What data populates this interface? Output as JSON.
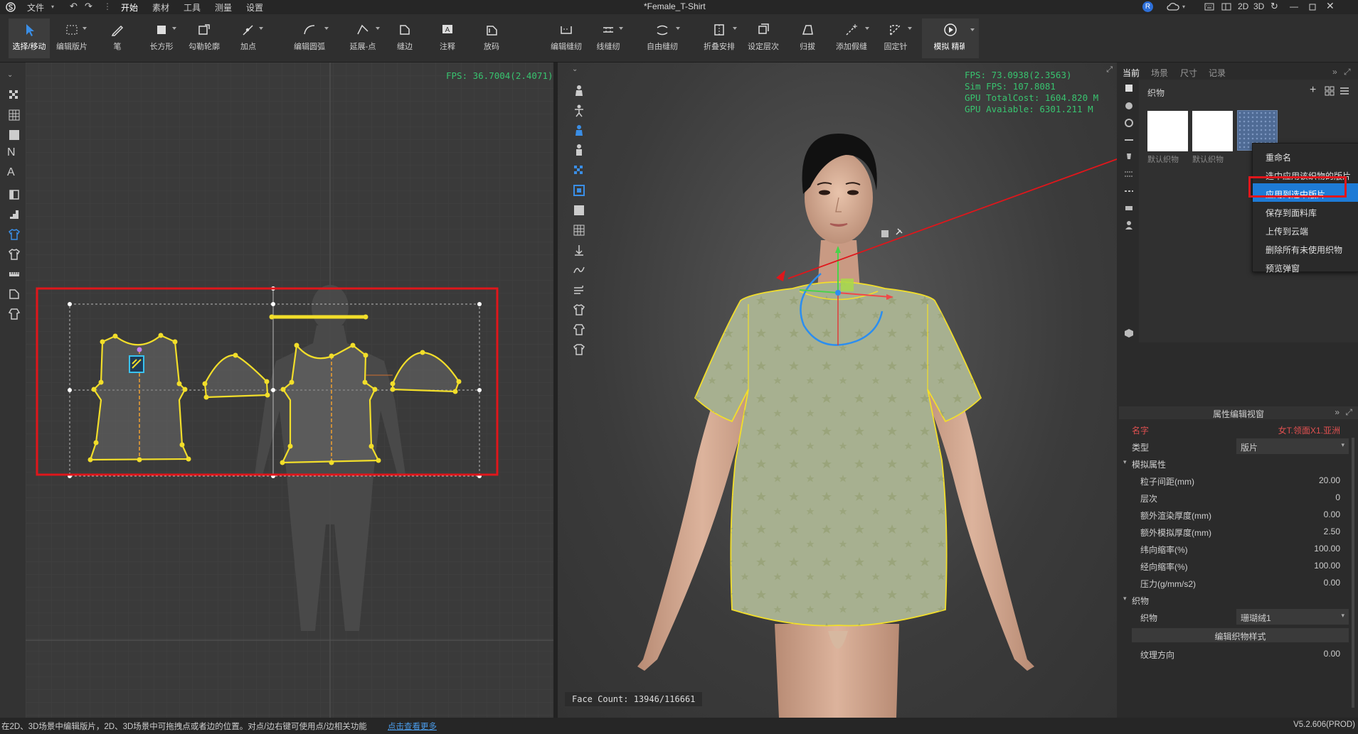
{
  "menubar": {
    "file": "文件",
    "items": [
      "开始",
      "素材",
      "工具",
      "测量",
      "设置"
    ],
    "title": "*Female_T-Shirt",
    "avatar": "R",
    "view_2d": "2D",
    "view_3d": "3D"
  },
  "toolbar": {
    "tools": [
      "选择/移动",
      "编辑版片",
      "笔",
      "长方形",
      "勾勒轮廓",
      "加点",
      "编辑圆弧",
      "延展-点",
      "缝边",
      "注释",
      "放码",
      "编辑缝纫",
      "线缝纫",
      "自由缝纫",
      "折叠安排",
      "设定层次",
      "归拔",
      "添加假缝",
      "固定针"
    ],
    "simulate": "模拟",
    "precise": "精确"
  },
  "viewport2d": {
    "fps": "FPS: 36.7004(2.4071)"
  },
  "viewport3d": {
    "hud": [
      "FPS: 73.0938(2.3563)",
      "Sim FPS: 107.8081",
      "GPU TotalCost: 1604.820 M",
      "GPU Avaiable: 6301.211 M"
    ],
    "face_count": "Face Count: 13946/116661"
  },
  "library": {
    "tabs": [
      "当前",
      "场景",
      "尺寸",
      "记录"
    ],
    "section": "织物",
    "fabrics": [
      "默认织物",
      "默认织物"
    ],
    "context_menu": [
      "重命名",
      "选中应用该织物的版片",
      "应用到选中版片",
      "保存到面料库",
      "上传到云端",
      "删除所有未使用织物",
      "预览弹窗"
    ],
    "highlighted": "应用到选中版片"
  },
  "properties": {
    "header": "属性编辑视窗",
    "name_label": "名字",
    "name_value": "女T.领面X1.亚洲",
    "type_label": "类型",
    "type_value": "版片",
    "sim_section": "模拟属性",
    "rows": [
      {
        "k": "粒子间距(mm)",
        "v": "20.00"
      },
      {
        "k": "层次",
        "v": "0"
      },
      {
        "k": "额外渲染厚度(mm)",
        "v": "0.00"
      },
      {
        "k": "额外模拟厚度(mm)",
        "v": "2.50"
      },
      {
        "k": "纬向缩率(%)",
        "v": "100.00"
      },
      {
        "k": "经向缩率(%)",
        "v": "100.00"
      },
      {
        "k": "压力(g/mm/s2)",
        "v": "0.00"
      }
    ],
    "fabric_section": "织物",
    "fabric_label": "织物",
    "fabric_value": "珊瑚绒1",
    "edit_fabric_btn": "编辑织物样式",
    "texture_dir_label": "纹理方向",
    "texture_dir_value": "0.00"
  },
  "status": {
    "text": "在2D、3D场景中编辑版片，2D、3D场景中可拖拽点或者边的位置。对点/边右键可使用点/边相关功能",
    "link": "点击查看更多",
    "version": "V5.2.606(PROD)"
  },
  "colors": {
    "accent": "#1e7bd6",
    "highlight_box": "#e0161b",
    "hud": "#38c36f",
    "pattern": "#f2de2a"
  }
}
